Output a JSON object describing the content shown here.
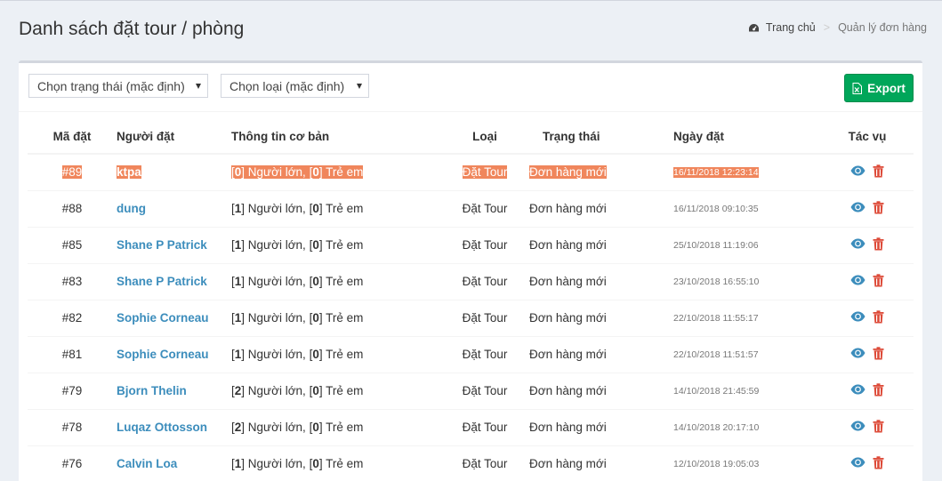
{
  "header": {
    "title": "Danh sách đặt tour / phòng",
    "breadcrumb_home": "Trang chủ",
    "breadcrumb_sep": ">",
    "breadcrumb_current": "Quản lý đơn hàng"
  },
  "filters": {
    "status_select": "Chọn trạng thái (mặc định)",
    "type_select": "Chọn loại (mặc định)",
    "export_label": "Export"
  },
  "table": {
    "columns": [
      "Mã đặt",
      "Người đặt",
      "Thông tin cơ bản",
      "Loại",
      "Trạng thái",
      "Ngày đặt",
      "Tác vụ"
    ],
    "rows": [
      {
        "code": "#89",
        "user": "ktpa",
        "adults": "0",
        "children": "0",
        "type": "Đặt Tour",
        "status": "Đơn hàng mới",
        "date": "16/11/2018 12:23:14"
      },
      {
        "code": "#88",
        "user": "dung",
        "adults": "1",
        "children": "0",
        "type": "Đặt Tour",
        "status": "Đơn hàng mới",
        "date": "16/11/2018 09:10:35"
      },
      {
        "code": "#85",
        "user": "Shane P Patrick",
        "adults": "1",
        "children": "0",
        "type": "Đặt Tour",
        "status": "Đơn hàng mới",
        "date": "25/10/2018 11:19:06"
      },
      {
        "code": "#83",
        "user": "Shane P Patrick",
        "adults": "1",
        "children": "0",
        "type": "Đặt Tour",
        "status": "Đơn hàng mới",
        "date": "23/10/2018 16:55:10"
      },
      {
        "code": "#82",
        "user": "Sophie Corneau",
        "adults": "1",
        "children": "0",
        "type": "Đặt Tour",
        "status": "Đơn hàng mới",
        "date": "22/10/2018 11:55:17"
      },
      {
        "code": "#81",
        "user": "Sophie Corneau",
        "adults": "1",
        "children": "0",
        "type": "Đặt Tour",
        "status": "Đơn hàng mới",
        "date": "22/10/2018 11:51:57"
      },
      {
        "code": "#79",
        "user": "Bjorn Thelin",
        "adults": "2",
        "children": "0",
        "type": "Đặt Tour",
        "status": "Đơn hàng mới",
        "date": "14/10/2018 21:45:59"
      },
      {
        "code": "#78",
        "user": "Luqaz Ottosson",
        "adults": "2",
        "children": "0",
        "type": "Đặt Tour",
        "status": "Đơn hàng mới",
        "date": "14/10/2018 20:17:10"
      },
      {
        "code": "#76",
        "user": "Calvin Loa",
        "adults": "1",
        "children": "0",
        "type": "Đặt Tour",
        "status": "Đơn hàng mới",
        "date": "12/10/2018 19:05:03"
      }
    ],
    "adult_label": "Người lớn,",
    "child_label": "Trẻ em"
  },
  "colors": {
    "highlight": "#f0865c",
    "link": "#3c8dbc",
    "export_bg": "#00a65a",
    "delete": "#dd4b39"
  },
  "icons": [
    "dashboard-icon",
    "excel-file-icon",
    "eye-icon",
    "trash-icon"
  ]
}
